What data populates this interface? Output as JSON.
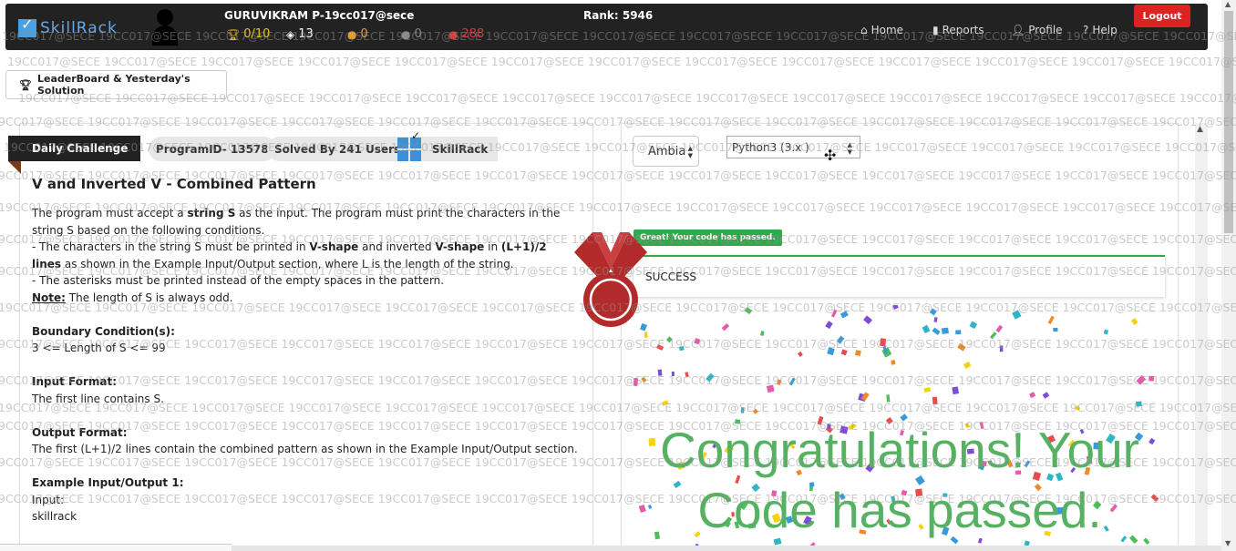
{
  "header": {
    "brand": "SkillRack",
    "username": "GURUVIKRAM P-19cc017@sece",
    "rank": "Rank: 5946",
    "stats": [
      {
        "icon": "trophy-icon",
        "value": "0/10",
        "color": "#f0c419"
      },
      {
        "icon": "layers-icon",
        "value": "13",
        "color": "#ffffff"
      },
      {
        "icon": "gold-medal-icon",
        "value": "0",
        "color": "#f0a020"
      },
      {
        "icon": "silver-medal-icon",
        "value": "0",
        "color": "#888888"
      },
      {
        "icon": "bronze-medal-icon",
        "value": "288",
        "color": "#d43a3a"
      }
    ],
    "nav": [
      "Home",
      "Reports",
      "Profile",
      "Help"
    ],
    "logout": "Logout"
  },
  "leaderboard_button": "LeaderBoard & Yesterday's Solution",
  "problem": {
    "badge": "Daily Challenge",
    "program_id": "ProgramID- 13578",
    "solved_by": "Solved By 241 Users",
    "brand": "SkillRack",
    "title": "V and Inverted V - Combined Pattern",
    "desc_1a": "The program must accept a ",
    "desc_1b": "string S",
    "desc_1c": " as the input. The program must print the characters in the string S based on the following conditions.",
    "desc_2a": "- The characters in the string S must be printed in ",
    "desc_2b": "V-shape",
    "desc_2c": " and inverted ",
    "desc_2d": "V-shape",
    "desc_2e": " in ",
    "desc_2f": "(L+1)/2 lines",
    "desc_2g": " as shown in the Example Input/Output section, where L is the length of the string.",
    "desc_3": "- The asterisks must be printed instead of the empty spaces in the pattern.",
    "note_label": "Note:",
    "note_text": " The length of S is always odd.",
    "boundary_label": "Boundary Condition(s):",
    "boundary_text": "3 <= Length of S <= 99",
    "input_label": "Input Format:",
    "input_text": "The first line contains S.",
    "output_label": "Output Format:",
    "output_text": "The first (L+1)/2 lines contain the combined pattern as shown in the Example Input/Output section.",
    "example_label": "Example Input/Output 1:",
    "example_input_label": "Input:",
    "example_input_value": "skillrack"
  },
  "editor": {
    "theme_value": "Ambia",
    "language_value": "Python3 (3.x )",
    "pass_badge": "Great! Your code has passed.",
    "result": "SUCCESS",
    "congrats": "Congratulations! Your Code has passed."
  },
  "watermark": "19CC017@SECE"
}
